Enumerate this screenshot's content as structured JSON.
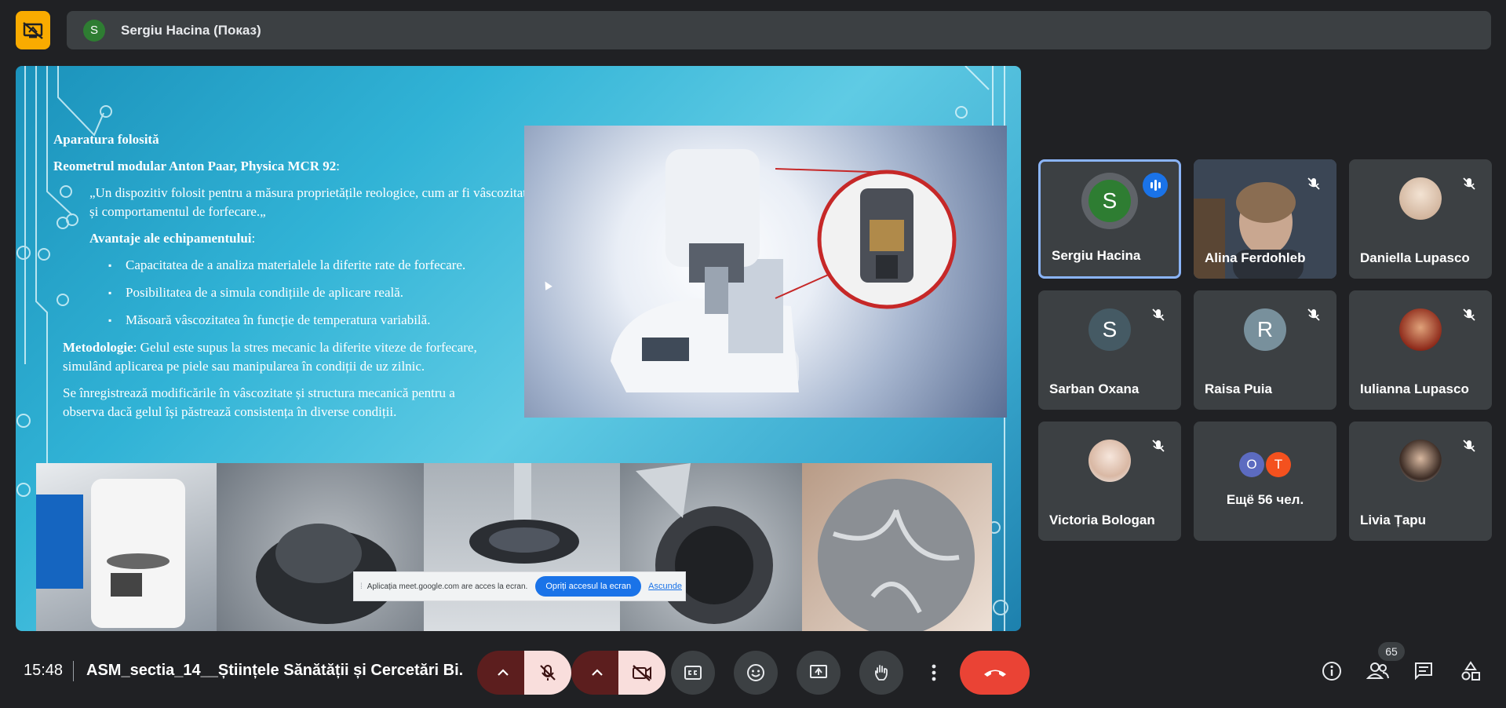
{
  "header": {
    "presenter_initial": "S",
    "presenter_label": "Sergiu Hacina (Показ)"
  },
  "slide": {
    "heading": "Aparatura folosită",
    "device_line": "Reometrul modular Anton Paar, Physica MCR 92",
    "device_colon": ":",
    "quote": "„Un dispozitiv folosit pentru a măsura proprietățile reologice, cum ar fi vâscozitatea și comportamentul de forfecare.„",
    "advantages_title": "Avantaje ale echipamentului",
    "advantages_colon": ":",
    "advantages": [
      "Capacitatea de a analiza materialele la diferite rate de forfecare.",
      "Posibilitatea de a simula condițiile de aplicare reală.",
      "Măsoară vâscozitatea în funcție de temperatura variabilă."
    ],
    "method_title": "Metodologie",
    "method_text": ": Gelul este supus la stres mecanic la diferite viteze de forfecare, simulând aplicarea pe piele sau manipularea în condiții de uz zilnic.",
    "record_text": "Se înregistrează modificările în vâscozitate și structura mecanică pentru a observa dacă gelul își păstrează consistența în diverse condiții."
  },
  "share_notice": {
    "text": "Aplicația meet.google.com are acces la ecran.",
    "stop_label": "Opriți accesul la ecran",
    "hide_label": "Ascunde"
  },
  "participants": [
    {
      "name": "Sergiu Hacina",
      "initial": "S",
      "color": "#2e7d32",
      "speaking": true
    },
    {
      "name": "Alina Ferdohleb",
      "video": true
    },
    {
      "name": "Daniella Lupasco",
      "photo": true
    },
    {
      "name": "Sarban Oxana",
      "initial": "S",
      "color": "#455a64"
    },
    {
      "name": "Raisa Puia",
      "initial": "R",
      "color": "#78909c"
    },
    {
      "name": "Iulianna Lupasco",
      "photo": true
    },
    {
      "name": "Victoria Bologan",
      "photo": true
    },
    {
      "name": "Livia Țapu",
      "photo": true
    }
  ],
  "more_tile": {
    "avatars": [
      {
        "initial": "O",
        "color": "#5c6bc0"
      },
      {
        "initial": "T",
        "color": "#f4511e"
      }
    ],
    "label": "Ещё 56 чел."
  },
  "bottom": {
    "time": "15:48",
    "meeting_title": "ASM_sectia_14__Științele Sănătății și Cercetări Bi...",
    "participant_count": "65"
  },
  "colors": {
    "accent": "#8ab4f8",
    "end_call": "#ea4335",
    "present_yellow": "#f9ab00",
    "muted_bg": "#f9dedc"
  }
}
